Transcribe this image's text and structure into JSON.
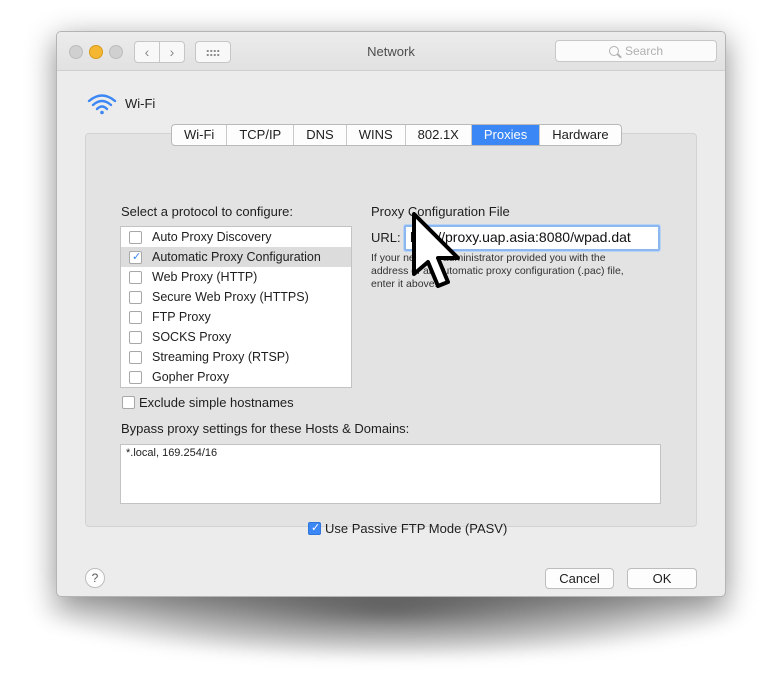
{
  "window": {
    "title": "Network"
  },
  "toolbar": {
    "back_icon": "chevron-left-icon",
    "forward_icon": "chevron-right-icon",
    "grid_icon": "grid-icon"
  },
  "search": {
    "placeholder": "Search"
  },
  "interface": {
    "name": "Wi-Fi",
    "icon": "wifi-icon"
  },
  "tabs": [
    {
      "label": "Wi-Fi",
      "active": false
    },
    {
      "label": "TCP/IP",
      "active": false
    },
    {
      "label": "DNS",
      "active": false
    },
    {
      "label": "WINS",
      "active": false
    },
    {
      "label": "802.1X",
      "active": false
    },
    {
      "label": "Proxies",
      "active": true
    },
    {
      "label": "Hardware",
      "active": false
    }
  ],
  "protocols": {
    "heading": "Select a protocol to configure:",
    "items": [
      {
        "label": "Auto Proxy Discovery",
        "checked": false,
        "selected": false
      },
      {
        "label": "Automatic Proxy Configuration",
        "checked": true,
        "selected": true
      },
      {
        "label": "Web Proxy (HTTP)",
        "checked": false,
        "selected": false
      },
      {
        "label": "Secure Web Proxy (HTTPS)",
        "checked": false,
        "selected": false
      },
      {
        "label": "FTP Proxy",
        "checked": false,
        "selected": false
      },
      {
        "label": "SOCKS Proxy",
        "checked": false,
        "selected": false
      },
      {
        "label": "Streaming Proxy (RTSP)",
        "checked": false,
        "selected": false
      },
      {
        "label": "Gopher Proxy",
        "checked": false,
        "selected": false
      }
    ]
  },
  "proxy_config": {
    "heading": "Proxy Configuration File",
    "url_label": "URL:",
    "url_value": "http://proxy.uap.asia:8080/wpad.dat",
    "help_line1": "If your network administrator provided you with the",
    "help_line2": "address of an automatic proxy configuration (.pac) file,",
    "help_line3": "enter it above."
  },
  "exclude_simple": {
    "label": "Exclude simple hostnames",
    "checked": false
  },
  "bypass": {
    "label": "Bypass proxy settings for these Hosts & Domains:",
    "value": "*.local, 169.254/16"
  },
  "passive_ftp": {
    "label": "Use Passive FTP Mode (PASV)",
    "checked": true
  },
  "buttons": {
    "help": "?",
    "cancel": "Cancel",
    "ok": "OK"
  },
  "colors": {
    "accent": "#3a87f5",
    "minimize": "#f5b731"
  }
}
